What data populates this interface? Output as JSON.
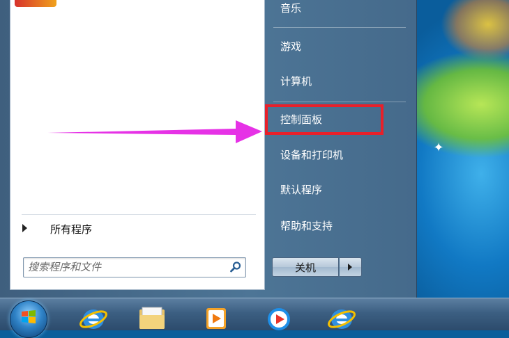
{
  "start_menu": {
    "all_programs_label": "所有程序",
    "search_placeholder": "搜索程序和文件",
    "right_items": [
      {
        "label": "音乐",
        "name": "menu-item-music"
      },
      {
        "label": "游戏",
        "name": "menu-item-games"
      },
      {
        "label": "计算机",
        "name": "menu-item-computer"
      },
      {
        "label": "控制面板",
        "name": "menu-item-control-panel",
        "highlighted": true
      },
      {
        "label": "设备和打印机",
        "name": "menu-item-devices-printers"
      },
      {
        "label": "默认程序",
        "name": "menu-item-default-programs"
      },
      {
        "label": "帮助和支持",
        "name": "menu-item-help-support"
      }
    ],
    "shutdown_label": "关机"
  },
  "annotation": {
    "highlight_color": "#e8202a",
    "arrow_color": "#e632e6"
  },
  "taskbar": {
    "icons": [
      "start-orb",
      "internet-explorer-icon",
      "folder-icon",
      "media-player-icon",
      "video-player-icon",
      "internet-explorer-icon"
    ]
  }
}
